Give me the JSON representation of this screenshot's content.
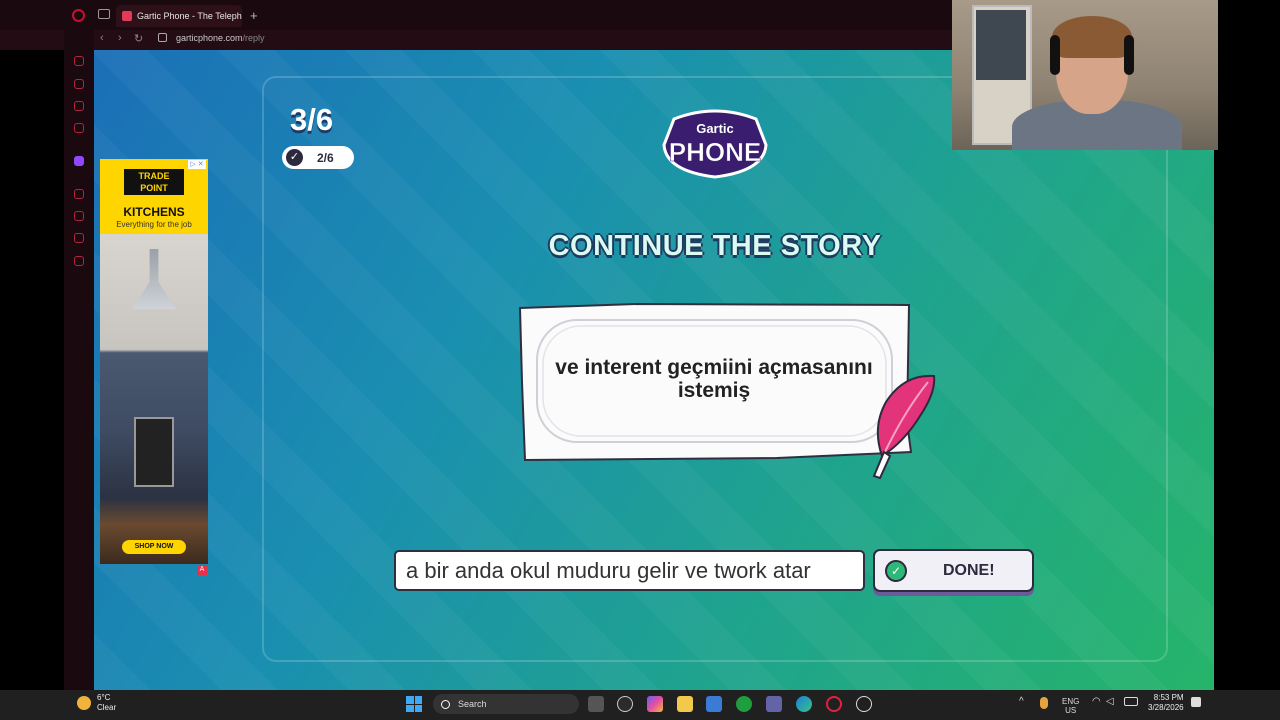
{
  "browser": {
    "tab_title": "Gartic Phone - The Teleph",
    "new_tab": "+",
    "url_domain": "garticphone.com",
    "url_path": "/reply",
    "back": "‹",
    "forward": "›",
    "reload": "↻"
  },
  "game": {
    "round": "3/6",
    "players_done": "2/6",
    "logo_top": "Gartic",
    "logo_bottom": "PHONE",
    "heading": "CONTINUE THE STORY",
    "previous_sentence": "ve interent geçmiini açmasanını istemiş",
    "story_input_value": "a bir anda okul muduru gelir ve twork atar",
    "done_button": "DONE!"
  },
  "ad": {
    "brand": "TRADE POINT",
    "headline": "KITCHENS",
    "tagline": "Everything for the job",
    "cta": "SHOP NOW",
    "choices_badge": "A"
  },
  "taskbar": {
    "weather_temp": "6°C",
    "weather_desc": "Clear",
    "search_placeholder": "Search",
    "lang_top": "ENG",
    "lang_bottom": "US",
    "time": "8:53 PM",
    "date": "3/28/2026"
  }
}
